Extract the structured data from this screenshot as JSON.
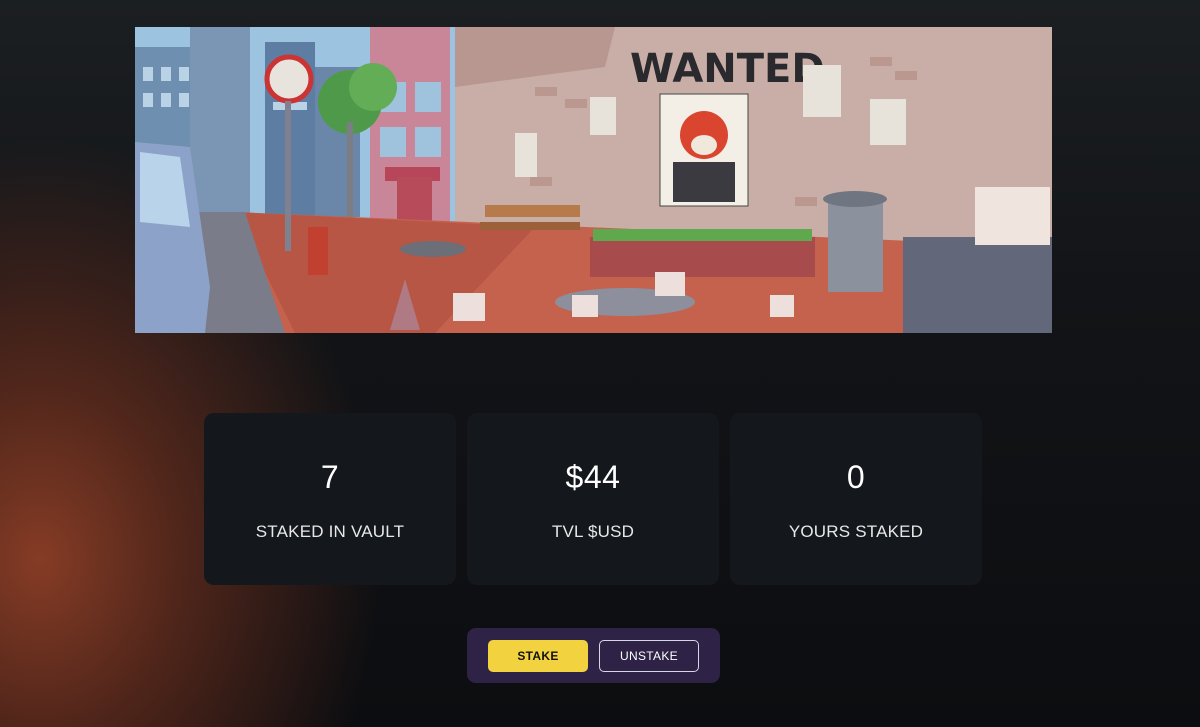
{
  "banner": {
    "sign_text": "WANTED"
  },
  "stats": [
    {
      "value": "7",
      "label": "STAKED IN VAULT"
    },
    {
      "value": "$44",
      "label": "TVL $USD"
    },
    {
      "value": "0",
      "label": "YOURS STAKED"
    }
  ],
  "actions": {
    "stake_label": "STAKE",
    "unstake_label": "UNSTAKE"
  },
  "colors": {
    "stake_button": "#f2d33f",
    "action_bar": "#2e2346",
    "card_bg": "#14171b"
  }
}
